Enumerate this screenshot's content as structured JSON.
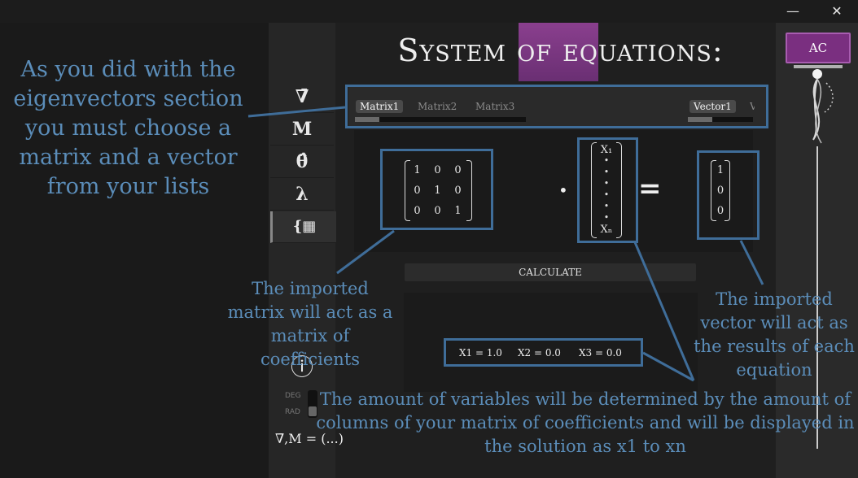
{
  "window": {
    "minimize_icon": "—",
    "close_icon": "✕"
  },
  "sidebar": {
    "items": [
      {
        "label": "∇̄",
        "name": "vector"
      },
      {
        "label": "M",
        "name": "matrix"
      },
      {
        "label": "θ̂",
        "name": "angle"
      },
      {
        "label": "λ",
        "name": "eigen"
      },
      {
        "label": "{▦",
        "name": "system"
      }
    ],
    "info_icon": "ⓘ",
    "deg_label": "DEG",
    "rad_label": "RAD",
    "footer_text": "∇̄,M = (...)"
  },
  "main": {
    "title": "System of equations:",
    "matrix_tabs": [
      "Matrix1",
      "Matrix2",
      "Matrix3"
    ],
    "selected_matrix_tab": "Matrix1",
    "vector_tabs": [
      "Vector1",
      "V"
    ],
    "selected_vector_tab": "Vector1",
    "matrix": [
      [
        "1",
        "0",
        "0"
      ],
      [
        "0",
        "1",
        "0"
      ],
      [
        "0",
        "0",
        "1"
      ]
    ],
    "dot": "•",
    "unknowns_top": "X₁",
    "unknowns_bottom": "Xₙ",
    "equals": "=",
    "vector": [
      "1",
      "0",
      "0"
    ],
    "calculate_label": "CALCULATE",
    "results": [
      "X1 = 1.0",
      "X2 = 0.0",
      "X3 = 0.0"
    ]
  },
  "right_panel": {
    "ac_label": "AC"
  },
  "annotations": {
    "choose": "As you did with the eigenvectors section you must choose a matrix and a vector from your lists",
    "matrix_coeff": "The imported matrix will act as a matrix of coefficients",
    "vector_results": "The imported vector will act as the results of each equation",
    "variables": "The amount of variables will be determined by the amount of columns of your matrix of coefficients and will be displayed in the solution as x1 to xn"
  },
  "colors": {
    "accent": "#7a2f80",
    "annotation": "#5b8db9",
    "highlight_border": "#3f6d99"
  }
}
